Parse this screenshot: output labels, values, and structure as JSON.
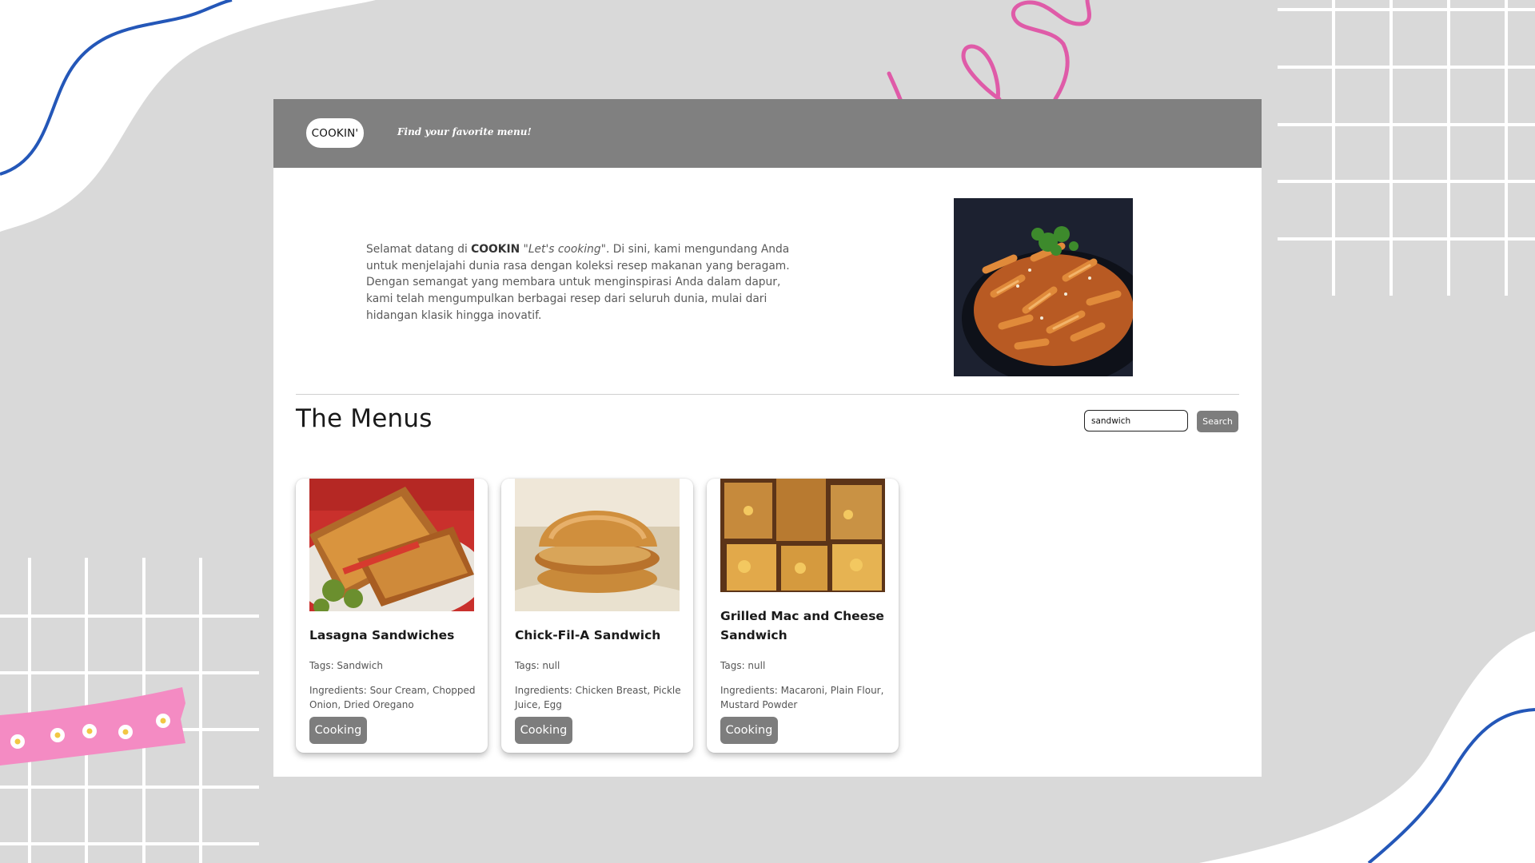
{
  "navbar": {
    "logo": "COOKIN'",
    "tagline": "Find your favorite menu!"
  },
  "hero": {
    "text_intro": "Selamat datang di ",
    "brand": "COOKIN",
    "motto": " \"Let's cooking\"",
    "text_rest": ". Di sini, kami mengundang Anda untuk menjelajahi dunia rasa dengan koleksi resep makanan yang beragam. Dengan semangat yang membara untuk menginspirasi Anda dalam dapur, kami telah mengumpulkan berbagai resep dari seluruh dunia, mulai dari hidangan klasik hingga inovatif."
  },
  "menus": {
    "title": "The Menus",
    "search_value": "sandwich",
    "search_button": "Search"
  },
  "cards": [
    {
      "title": "Lasagna Sandwiches",
      "tags": "Tags: Sandwich",
      "ingredients": "Ingredients: Sour Cream, Chopped Onion, Dried Oregano",
      "button": "Cooking"
    },
    {
      "title": "Chick-Fil-A Sandwich",
      "tags": "Tags: null",
      "ingredients": "Ingredients: Chicken Breast, Pickle Juice, Egg",
      "button": "Cooking"
    },
    {
      "title": "Grilled Mac and Cheese Sandwich",
      "tags": "Tags: null",
      "ingredients": "Ingredients: Macaroni, Plain Flour, Mustard Powder",
      "button": "Cooking"
    }
  ],
  "colors": {
    "background": "#d9d9d9",
    "navbar": "#808080",
    "button": "#7d7d7d",
    "accent_blue": "#2457b8",
    "accent_pink": "#df5ba8",
    "tape_pink": "#f48bc3"
  }
}
